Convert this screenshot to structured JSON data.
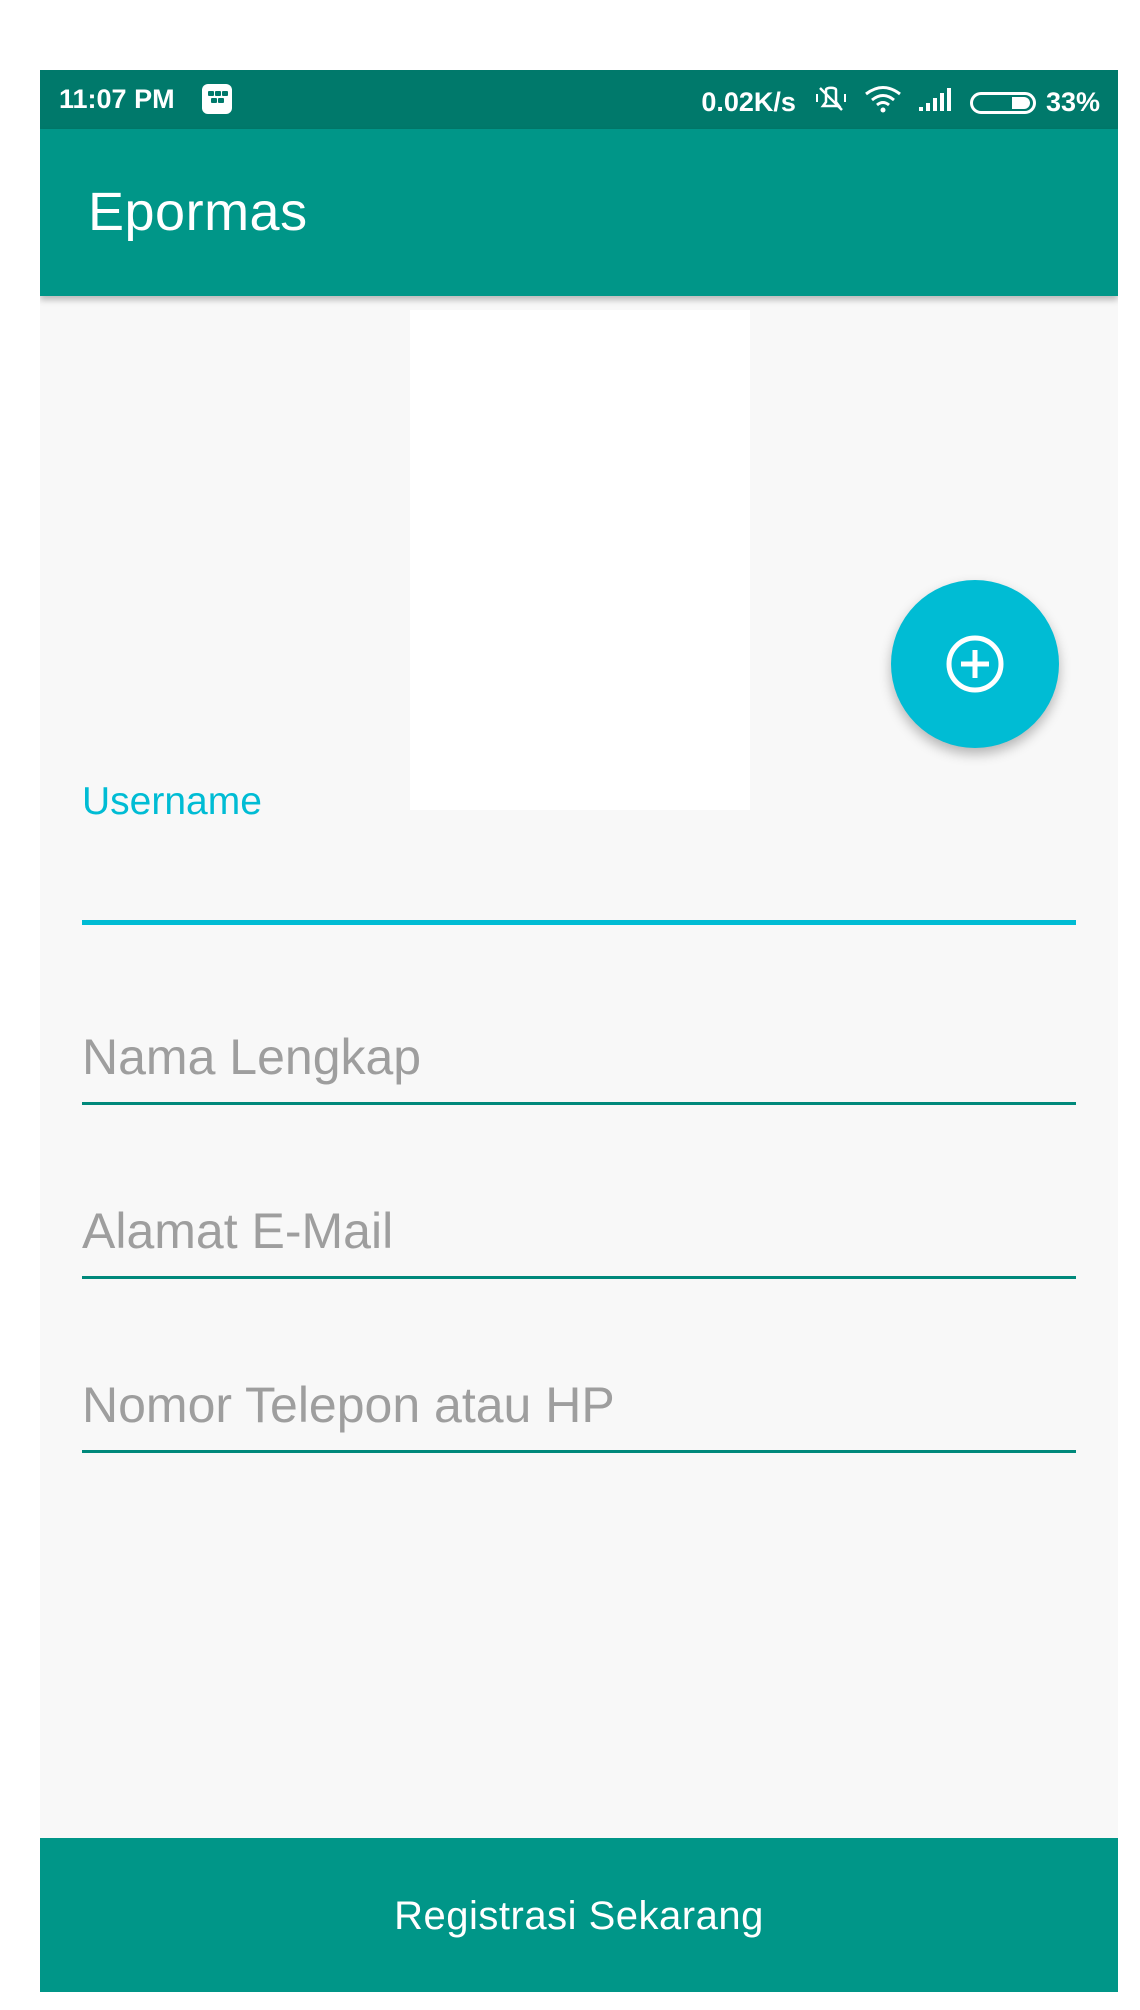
{
  "status_bar": {
    "time": "11:07 PM",
    "net_speed": "0.02K/s",
    "battery_percent": "33%",
    "icons": [
      "bbm-icon",
      "mute-vibrate-icon",
      "wifi-icon",
      "cell-signal-icon",
      "battery-icon"
    ]
  },
  "app_bar": {
    "title": "Epormas"
  },
  "photo": {
    "add_button_icon": "add-circle-icon"
  },
  "form": {
    "username_label": "Username",
    "username_value": "",
    "fullname_placeholder": "Nama Lengkap",
    "email_placeholder": "Alamat E-Mail",
    "phone_placeholder": "Nomor Telepon atau HP"
  },
  "footer": {
    "register_label": "Registrasi Sekarang"
  },
  "colors": {
    "status_bar": "#00796b",
    "primary": "#009688",
    "accent": "#00bcd4",
    "background": "#f8f8f8"
  }
}
